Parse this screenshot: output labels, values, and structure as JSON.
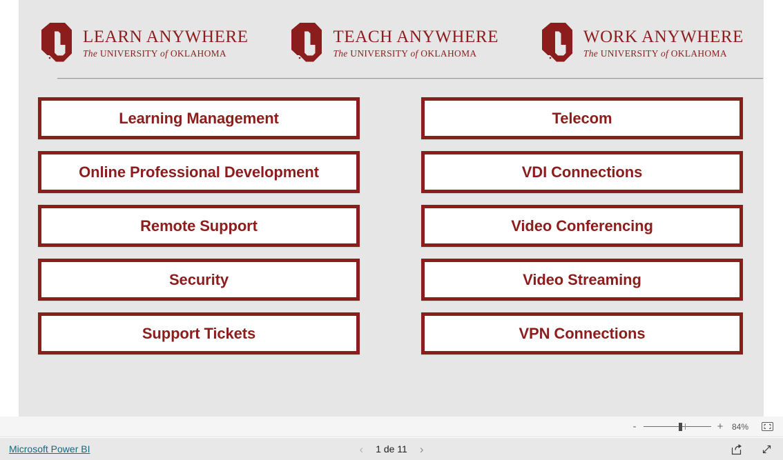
{
  "brand": {
    "maroon": "#8c1d1d",
    "canvas_bg": "#e6e6e6",
    "link_color": "#16697e"
  },
  "report": {
    "logos": [
      {
        "mark": "ou-logo-icon",
        "title": "LEARN ANYWHERE",
        "sub_the": "The",
        "sub_university": "UNIVERSITY",
        "sub_of": "of",
        "sub_oklahoma": "OKLAHOMA"
      },
      {
        "mark": "ou-logo-icon",
        "title": "TEACH ANYWHERE",
        "sub_the": "The",
        "sub_university": "UNIVERSITY",
        "sub_of": "of",
        "sub_oklahoma": "OKLAHOMA"
      },
      {
        "mark": "ou-logo-icon",
        "title": "WORK ANYWHERE",
        "sub_the": "The",
        "sub_university": "UNIVERSITY",
        "sub_of": "of",
        "sub_oklahoma": "OKLAHOMA"
      }
    ],
    "left_column": [
      {
        "label": "Learning Management"
      },
      {
        "label": "Online Professional Development"
      },
      {
        "label": "Remote Support"
      },
      {
        "label": "Security"
      },
      {
        "label": "Support Tickets"
      }
    ],
    "right_column": [
      {
        "label": "Telecom"
      },
      {
        "label": "VDI Connections"
      },
      {
        "label": "Video Conferencing"
      },
      {
        "label": "Video Streaming"
      },
      {
        "label": "VPN Connections"
      }
    ]
  },
  "zoom_bar": {
    "minus_label": "-",
    "plus_label": "+",
    "value": "84%",
    "fit_icon": "fit-to-page-icon"
  },
  "status_bar": {
    "powerbi_link": "Microsoft Power BI",
    "prev_arrow": "‹",
    "next_arrow": "›",
    "page_label": "1 de 11",
    "share_icon": "share-icon",
    "fullscreen_icon": "fullscreen-icon"
  }
}
